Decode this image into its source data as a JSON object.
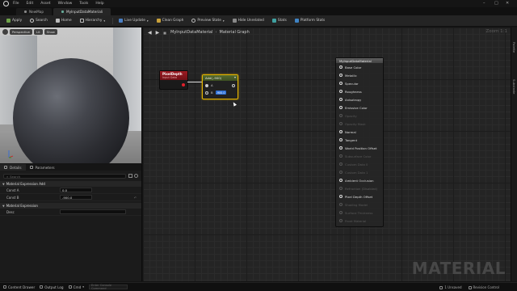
{
  "menu": {
    "items": [
      "File",
      "Edit",
      "Asset",
      "Window",
      "Tools",
      "Help"
    ]
  },
  "tabs": [
    {
      "label": "NewMap",
      "active": false
    },
    {
      "label": "MyInputDataMateriali",
      "active": true
    }
  ],
  "toolbar": {
    "buttons": [
      {
        "label": "Apply",
        "icon": "save-icon"
      },
      {
        "label": "Search",
        "icon": "search-icon"
      },
      {
        "label": "Home",
        "icon": "home-icon"
      },
      {
        "label": "Hierarchy",
        "icon": "hierarchy-icon"
      },
      {
        "label": "Live Update",
        "icon": "live-update-icon"
      },
      {
        "label": "Clean Graph",
        "icon": "clean-graph-icon"
      },
      {
        "label": "Preview State",
        "icon": "preview-state-icon"
      },
      {
        "label": "Hide Unrelated",
        "icon": "hide-unrelated-icon"
      },
      {
        "label": "Stats",
        "icon": "stats-icon"
      },
      {
        "label": "Platform Stats",
        "icon": "platform-stats-icon"
      }
    ]
  },
  "viewport": {
    "buttons": [
      "Perspective",
      "Lit",
      "Show"
    ]
  },
  "details": {
    "tabs": [
      "Details",
      "Parameters"
    ],
    "search_placeholder": "Search",
    "sections": [
      {
        "title": "Material Expression Add",
        "rows": [
          {
            "label": "Const A",
            "value": "0.0",
            "reset": ""
          },
          {
            "label": "Const B",
            "value": "-900.0",
            "reset": "↶"
          }
        ]
      },
      {
        "title": "Material Expression",
        "rows": [
          {
            "label": "Desc",
            "value": "",
            "reset": ""
          }
        ]
      }
    ]
  },
  "graph": {
    "breadcrumb": [
      "MyInputDataMaterial",
      "Material Graph"
    ],
    "zoom": "Zoom 1:1",
    "watermark": "MATERIAL",
    "side_rail": [
      "Palette",
      "Substrate"
    ],
    "pixel_depth_node": {
      "title": "PixelDepth",
      "subtitle": "Input Data"
    },
    "add_node": {
      "title": "Add(,-900)",
      "pin_a": "A",
      "pin_b": "B",
      "b_value": "-900.0"
    },
    "material_node": {
      "title": "MyInputDataMaterial",
      "pins": [
        {
          "label": "Base Color",
          "enabled": true
        },
        {
          "label": "Metallic",
          "enabled": true
        },
        {
          "label": "Specular",
          "enabled": true
        },
        {
          "label": "Roughness",
          "enabled": true
        },
        {
          "label": "Anisotropy",
          "enabled": true
        },
        {
          "label": "Emissive Color",
          "enabled": true
        },
        {
          "label": "Opacity",
          "enabled": false
        },
        {
          "label": "Opacity Mask",
          "enabled": false
        },
        {
          "label": "Normal",
          "enabled": true
        },
        {
          "label": "Tangent",
          "enabled": true
        },
        {
          "label": "World Position Offset",
          "enabled": true
        },
        {
          "label": "Subsurface Color",
          "enabled": false
        },
        {
          "label": "Custom Data 0",
          "enabled": false
        },
        {
          "label": "Custom Data 1",
          "enabled": false
        },
        {
          "label": "Ambient Occlusion",
          "enabled": true
        },
        {
          "label": "Refraction (Disabled)",
          "enabled": false
        },
        {
          "label": "Pixel Depth Offset",
          "enabled": true
        },
        {
          "label": "Shading Model",
          "enabled": false
        },
        {
          "label": "Surface Thickness",
          "enabled": false
        },
        {
          "label": "Front Material",
          "enabled": false
        }
      ]
    }
  },
  "statusbar": {
    "items": [
      "Content Drawer",
      "Output Log",
      "Cmd"
    ],
    "cmd_placeholder": "Enter Console Command",
    "unsaved": "1 Unsaved",
    "revision": "Revision Control"
  },
  "colors": {
    "selection": "#e5b400",
    "pixel_depth_header": "#9e1a22",
    "add_header": "#556b2f",
    "value_field": "#2d6fd6"
  }
}
